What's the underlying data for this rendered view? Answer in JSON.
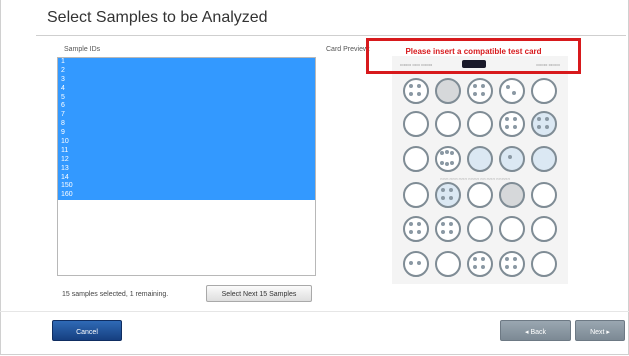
{
  "dialog": {
    "title": "Select Samples to be Analyzed"
  },
  "samples": {
    "label": "Sample IDs",
    "items": [
      "1",
      "2",
      "3",
      "4",
      "5",
      "6",
      "7",
      "8",
      "9",
      "10",
      "11",
      "12",
      "13",
      "14",
      "150",
      "160"
    ],
    "status": "15 samples selected, 1 remaining.",
    "select_next_label": "Select Next 15 Samples"
  },
  "card_preview": {
    "label": "Card Preview:",
    "warning": "Please insert a compatible test card"
  },
  "footer": {
    "cancel_label": "Cancel",
    "back_label": "◂ Back",
    "next_label": "Next ▸"
  },
  "colors": {
    "selection": "#3399ff",
    "warning": "#d7191c",
    "primary_button": "#1d4f99",
    "secondary_button": "#8a97a2"
  }
}
